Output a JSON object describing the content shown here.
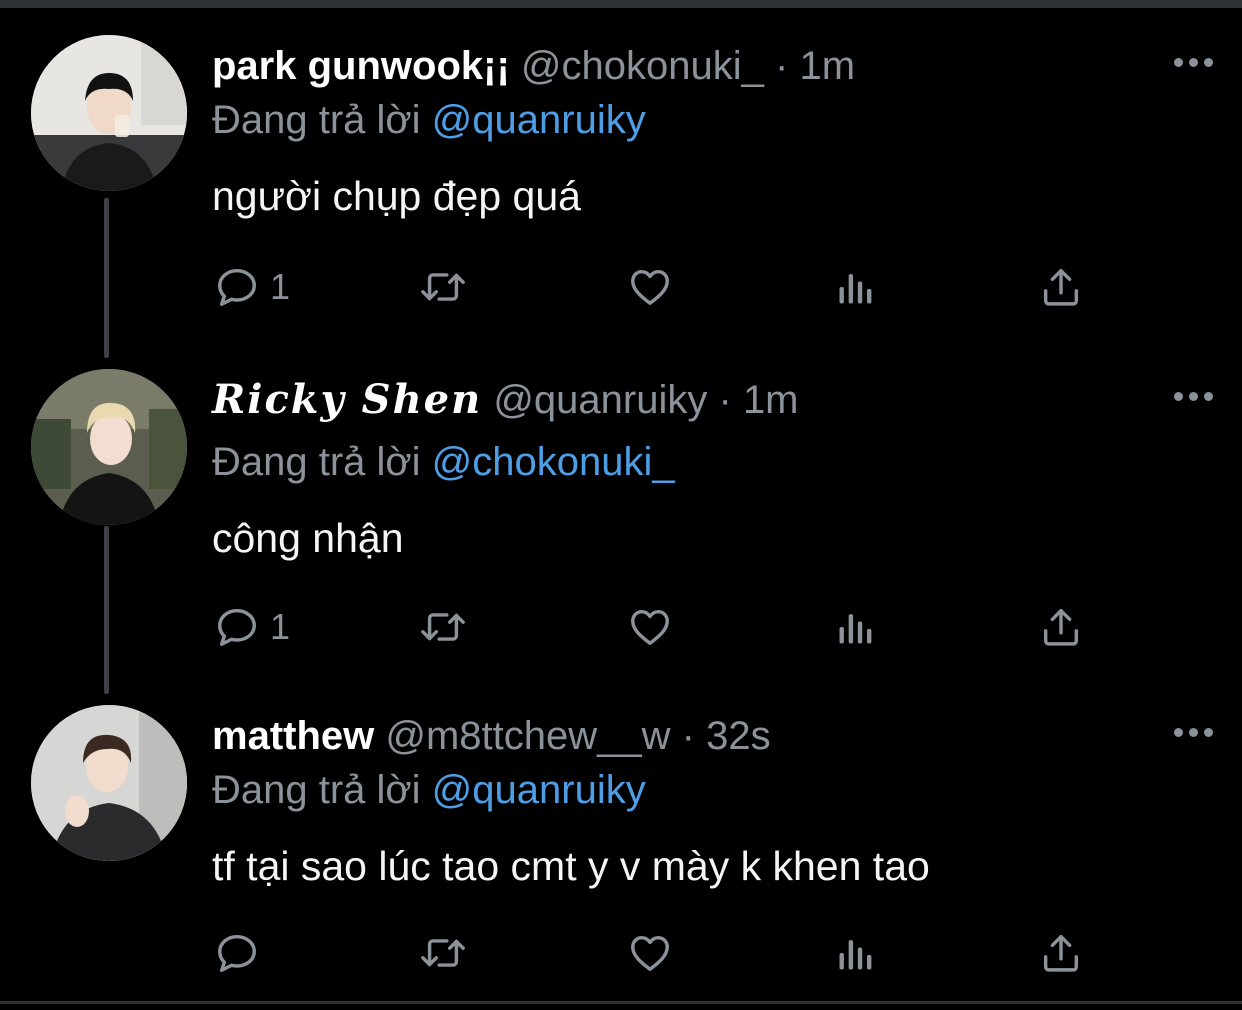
{
  "tweets": [
    {
      "display_name": "park gunwook¡¡",
      "handle": "@chokonuki_",
      "separator": "·",
      "time": "1m",
      "reply_prefix": "Đang trả lời",
      "reply_to": "@quanruiky",
      "text": "người chụp đẹp quá",
      "reply_count": "1"
    },
    {
      "display_name": "Ricky Shen",
      "handle": "@quanruiky",
      "separator": "·",
      "time": "1m",
      "reply_prefix": "Đang trả lời",
      "reply_to": "@chokonuki_",
      "text": "công nhận",
      "reply_count": "1"
    },
    {
      "display_name": "matthew",
      "handle": "@m8ttchew__w",
      "separator": "·",
      "time": "32s",
      "reply_prefix": "Đang trả lời",
      "reply_to": "@quanruiky",
      "text": "tf tại sao lúc tao cmt y v mày k khen tao",
      "reply_count": ""
    }
  ],
  "icons": {
    "reply": "reply-icon",
    "retweet": "retweet-icon",
    "like": "heart-icon",
    "analytics": "analytics-icon",
    "share": "share-icon",
    "more": "more-icon"
  },
  "colors": {
    "background": "#000000",
    "text": "#ffffff",
    "secondary": "#8b9299",
    "mention": "#4e9ee6",
    "thread_line": "#3d4147"
  }
}
